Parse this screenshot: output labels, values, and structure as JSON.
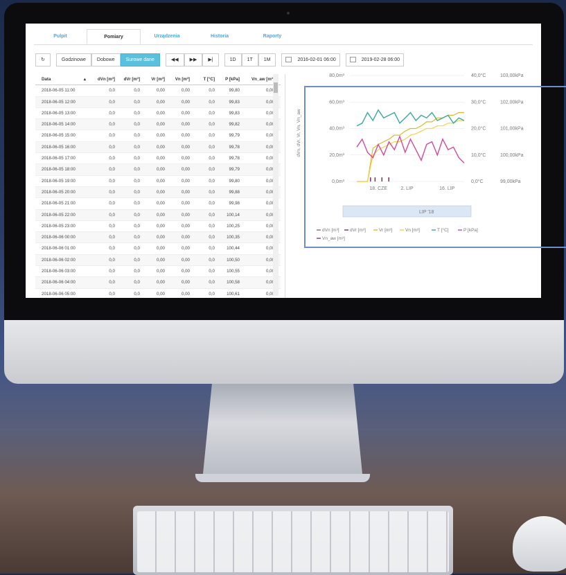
{
  "tabs": [
    "Pulpit",
    "Pomiary",
    "Urządzenia",
    "Historia",
    "Raporty"
  ],
  "toolbar": {
    "refresh_icon": "refresh-icon",
    "granularity": [
      "Godzinowe",
      "Dobowe",
      "Surowe dane"
    ],
    "active_granularity": "Surowe dane",
    "nav": [
      "◀◀",
      "▶▶",
      "▶|"
    ],
    "ranges": [
      "1D",
      "1T",
      "1M"
    ],
    "date_from": "2016-02-01 06:00",
    "date_to": "2019-02-28 06:00"
  },
  "table": {
    "headers": [
      "Data",
      "dVn [m³]",
      "dVr [m³]",
      "Vr [m³]",
      "Vn [m³]",
      "T [°C]",
      "P [kPa]",
      "Vn_aw [m³]"
    ],
    "rows": [
      [
        "2018-06-05 11:00",
        "0,0",
        "0,0",
        "0,00",
        "0,00",
        "0,0",
        "99,80",
        "0,00"
      ],
      [
        "2018-06-05 12:00",
        "0,0",
        "0,0",
        "0,00",
        "0,00",
        "0,0",
        "99,83",
        "0,00"
      ],
      [
        "2018-06-05 13:00",
        "0,0",
        "0,0",
        "0,00",
        "0,00",
        "0,0",
        "99,83",
        "0,00"
      ],
      [
        "2018-06-05 14:00",
        "0,0",
        "0,0",
        "0,00",
        "0,00",
        "0,0",
        "99,82",
        "0,00"
      ],
      [
        "2018-06-05 15:00",
        "0,0",
        "0,0",
        "0,00",
        "0,00",
        "0,0",
        "99,79",
        "0,00"
      ],
      [
        "2018-06-05 16:00",
        "0,0",
        "0,0",
        "0,00",
        "0,00",
        "0,0",
        "99,78",
        "0,00"
      ],
      [
        "2018-06-05 17:00",
        "0,0",
        "0,0",
        "0,00",
        "0,00",
        "0,0",
        "99,78",
        "0,00"
      ],
      [
        "2018-06-05 18:00",
        "0,0",
        "0,0",
        "0,00",
        "0,00",
        "0,0",
        "99,79",
        "0,00"
      ],
      [
        "2018-06-05 19:00",
        "0,0",
        "0,0",
        "0,00",
        "0,00",
        "0,0",
        "99,80",
        "0,00"
      ],
      [
        "2018-06-05 20:00",
        "0,0",
        "0,0",
        "0,00",
        "0,00",
        "0,0",
        "99,88",
        "0,00"
      ],
      [
        "2018-06-05 21:00",
        "0,0",
        "0,0",
        "0,00",
        "0,00",
        "0,0",
        "99,98",
        "0,00"
      ],
      [
        "2018-06-05 22:00",
        "0,0",
        "0,0",
        "0,00",
        "0,00",
        "0,0",
        "100,14",
        "0,00"
      ],
      [
        "2018-06-05 23:00",
        "0,0",
        "0,0",
        "0,00",
        "0,00",
        "0,0",
        "100,25",
        "0,00"
      ],
      [
        "2018-06-06 00:00",
        "0,0",
        "0,0",
        "0,00",
        "0,00",
        "0,0",
        "100,35",
        "0,00"
      ],
      [
        "2018-06-06 01:00",
        "0,0",
        "0,0",
        "0,00",
        "0,00",
        "0,0",
        "100,44",
        "0,00"
      ],
      [
        "2018-06-06 02:00",
        "0,0",
        "0,0",
        "0,00",
        "0,00",
        "0,0",
        "100,50",
        "0,00"
      ],
      [
        "2018-06-06 03:00",
        "0,0",
        "0,0",
        "0,00",
        "0,00",
        "0,0",
        "100,55",
        "0,00"
      ],
      [
        "2018-06-06 04:00",
        "0,0",
        "0,0",
        "0,00",
        "0,00",
        "0,0",
        "100,58",
        "0,00"
      ],
      [
        "2018-06-06 05:00",
        "0,0",
        "0,0",
        "0,00",
        "0,00",
        "0,0",
        "100,61",
        "0,00"
      ]
    ]
  },
  "chart_data": {
    "type": "line",
    "ylabel": "dVn, dVr, Vr, Vn, Vn_aw",
    "y_left_ticks": [
      "80,0m³",
      "60,0m³",
      "40,0m³",
      "20,0m³",
      "0,0m³"
    ],
    "y_temp_ticks": [
      "40,0°C",
      "30,0°C",
      "20,0°C",
      "10,0°C",
      "0,0°C"
    ],
    "y_press_ticks": [
      "103,00kPa",
      "102,00kPa",
      "101,00kPa",
      "100,00kPa",
      "99,00kPa"
    ],
    "x_ticks": [
      "18. CZE",
      "2. LIP",
      "16. LIP"
    ],
    "navigator_label": "LIP '18",
    "legend": [
      "dVn [m³]",
      "dVr [m³]",
      "Vr [m³]",
      "Vn [m³]",
      "T [°C]",
      "P [kPa]",
      "Vn_aw [m³]"
    ],
    "colors": {
      "dVn": "#8b6b6b",
      "dVr": "#8a2a4a",
      "Vr": "#e0b82a",
      "Vn": "#f2d24a",
      "T": "#3aa99a",
      "P": "#d24a9a",
      "Vn_aw": "#6b4a7a"
    },
    "series": [
      {
        "name": "T [°C]",
        "values": [
          21,
          22,
          26,
          23,
          27,
          24,
          25,
          26,
          22,
          24,
          26,
          23,
          25,
          24,
          26,
          23,
          24,
          25,
          22,
          24,
          23
        ]
      },
      {
        "name": "P [kPa]",
        "values": [
          100.3,
          100.6,
          100.1,
          99.9,
          100.4,
          100.0,
          100.5,
          100.2,
          100.7,
          100.1,
          100.6,
          100.2,
          99.8,
          100.4,
          100.5,
          100.0,
          100.6,
          100.2,
          100.3,
          99.9,
          99.7
        ]
      },
      {
        "name": "Vr [m³]",
        "values": [
          0,
          0,
          0,
          25,
          28,
          30,
          32,
          35,
          35,
          38,
          40,
          40,
          42,
          45,
          45,
          48,
          48,
          50,
          50,
          52,
          52
        ]
      },
      {
        "name": "Vn [m³]",
        "values": [
          0,
          0,
          0,
          20,
          24,
          26,
          28,
          30,
          30,
          32,
          35,
          36,
          38,
          40,
          40,
          42,
          42,
          44,
          44,
          46,
          46
        ]
      }
    ]
  }
}
